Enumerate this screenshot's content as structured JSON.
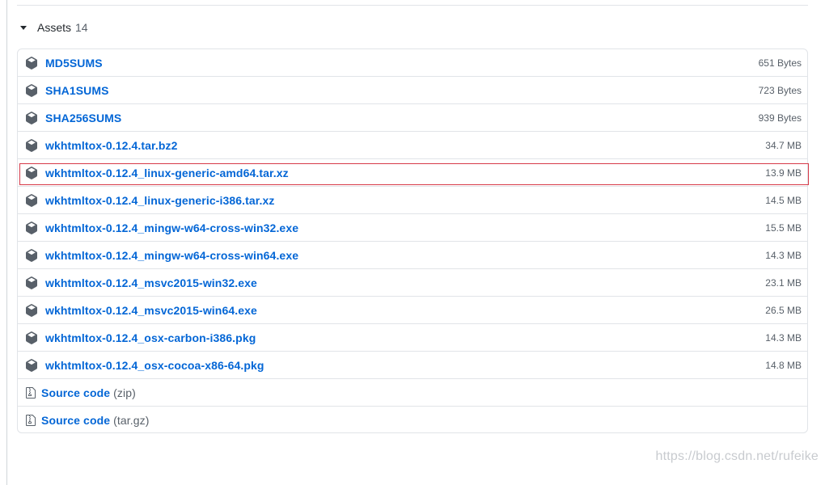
{
  "assets": {
    "title": "Assets",
    "count": "14",
    "items": [
      {
        "name": "MD5SUMS",
        "size": "651 Bytes"
      },
      {
        "name": "SHA1SUMS",
        "size": "723 Bytes"
      },
      {
        "name": "SHA256SUMS",
        "size": "939 Bytes"
      },
      {
        "name": "wkhtmltox-0.12.4.tar.bz2",
        "size": "34.7 MB"
      },
      {
        "name": "wkhtmltox-0.12.4_linux-generic-amd64.tar.xz",
        "size": "13.9 MB"
      },
      {
        "name": "wkhtmltox-0.12.4_linux-generic-i386.tar.xz",
        "size": "14.5 MB"
      },
      {
        "name": "wkhtmltox-0.12.4_mingw-w64-cross-win32.exe",
        "size": "15.5 MB"
      },
      {
        "name": "wkhtmltox-0.12.4_mingw-w64-cross-win64.exe",
        "size": "14.3 MB"
      },
      {
        "name": "wkhtmltox-0.12.4_msvc2015-win32.exe",
        "size": "23.1 MB"
      },
      {
        "name": "wkhtmltox-0.12.4_msvc2015-win64.exe",
        "size": "26.5 MB"
      },
      {
        "name": "wkhtmltox-0.12.4_osx-carbon-i386.pkg",
        "size": "14.3 MB"
      },
      {
        "name": "wkhtmltox-0.12.4_osx-cocoa-x86-64.pkg",
        "size": "14.8 MB"
      }
    ],
    "source": [
      {
        "label": "Source code",
        "format": "(zip)"
      },
      {
        "label": "Source code",
        "format": "(tar.gz)"
      }
    ]
  },
  "watermark": "https://blog.csdn.net/rufeike",
  "colors": {
    "link": "#0366d6",
    "muted": "#586069",
    "highlight": "#d73a49",
    "border": "#e1e4e8"
  },
  "icons": {
    "package": "package-icon",
    "file_zip": "file-zip-icon",
    "caret": "triangle-down-icon"
  }
}
